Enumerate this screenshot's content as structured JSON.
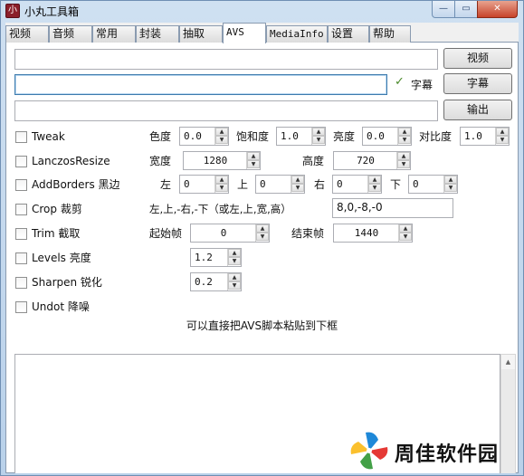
{
  "window": {
    "title": "小丸工具箱",
    "icon": "app-icon",
    "controls": {
      "minimize": "—",
      "maximize": "▭",
      "close": "✕"
    }
  },
  "tabs": [
    {
      "label": "视频",
      "active": false
    },
    {
      "label": "音频",
      "active": false
    },
    {
      "label": "常用",
      "active": false
    },
    {
      "label": "封装",
      "active": false
    },
    {
      "label": "抽取",
      "active": false
    },
    {
      "label": "AVS",
      "active": true
    },
    {
      "label": "MediaInfo",
      "active": false
    },
    {
      "label": "设置",
      "active": false
    },
    {
      "label": "帮助",
      "active": false
    }
  ],
  "files": {
    "video_path": "",
    "subtitle_path": "",
    "output_path": "",
    "video_button": "视频",
    "subtitle_checkbox_label": "字幕",
    "subtitle_checked": true,
    "subtitle_button": "字幕",
    "output_button": "输出"
  },
  "filters": {
    "tweak": {
      "label": "Tweak",
      "checked": false,
      "hue_label": "色度",
      "hue": "0.0",
      "saturation_label": "饱和度",
      "saturation": "1.0",
      "brightness_label": "亮度",
      "brightness": "0.0",
      "contrast_label": "对比度",
      "contrast": "1.0"
    },
    "lanczos": {
      "label": "LanczosResize",
      "checked": false,
      "width_label": "宽度",
      "width": "1280",
      "height_label": "高度",
      "height": "720"
    },
    "addborders": {
      "label": "AddBorders 黑边",
      "checked": false,
      "left_label": "左",
      "left": "0",
      "top_label": "上",
      "top": "0",
      "right_label": "右",
      "right": "0",
      "bottom_label": "下",
      "bottom": "0"
    },
    "crop": {
      "label": "Crop 裁剪",
      "checked": false,
      "format_hint": "左,上,-右,-下（或左,上,宽,高）",
      "value": "8,0,-8,-0"
    },
    "trim": {
      "label": "Trim 截取",
      "checked": false,
      "start_label": "起始帧",
      "start": "0",
      "end_label": "结束帧",
      "end": "1440"
    },
    "levels": {
      "label": "Levels 亮度",
      "checked": false,
      "value": "1.2"
    },
    "sharpen": {
      "label": "Sharpen 锐化",
      "checked": false,
      "value": "0.2"
    },
    "undot": {
      "label": "Undot 降噪",
      "checked": false
    }
  },
  "script": {
    "hint": "可以直接把AVS脚本粘贴到下框",
    "content": ""
  },
  "watermark": {
    "text": "周佳软件园"
  }
}
